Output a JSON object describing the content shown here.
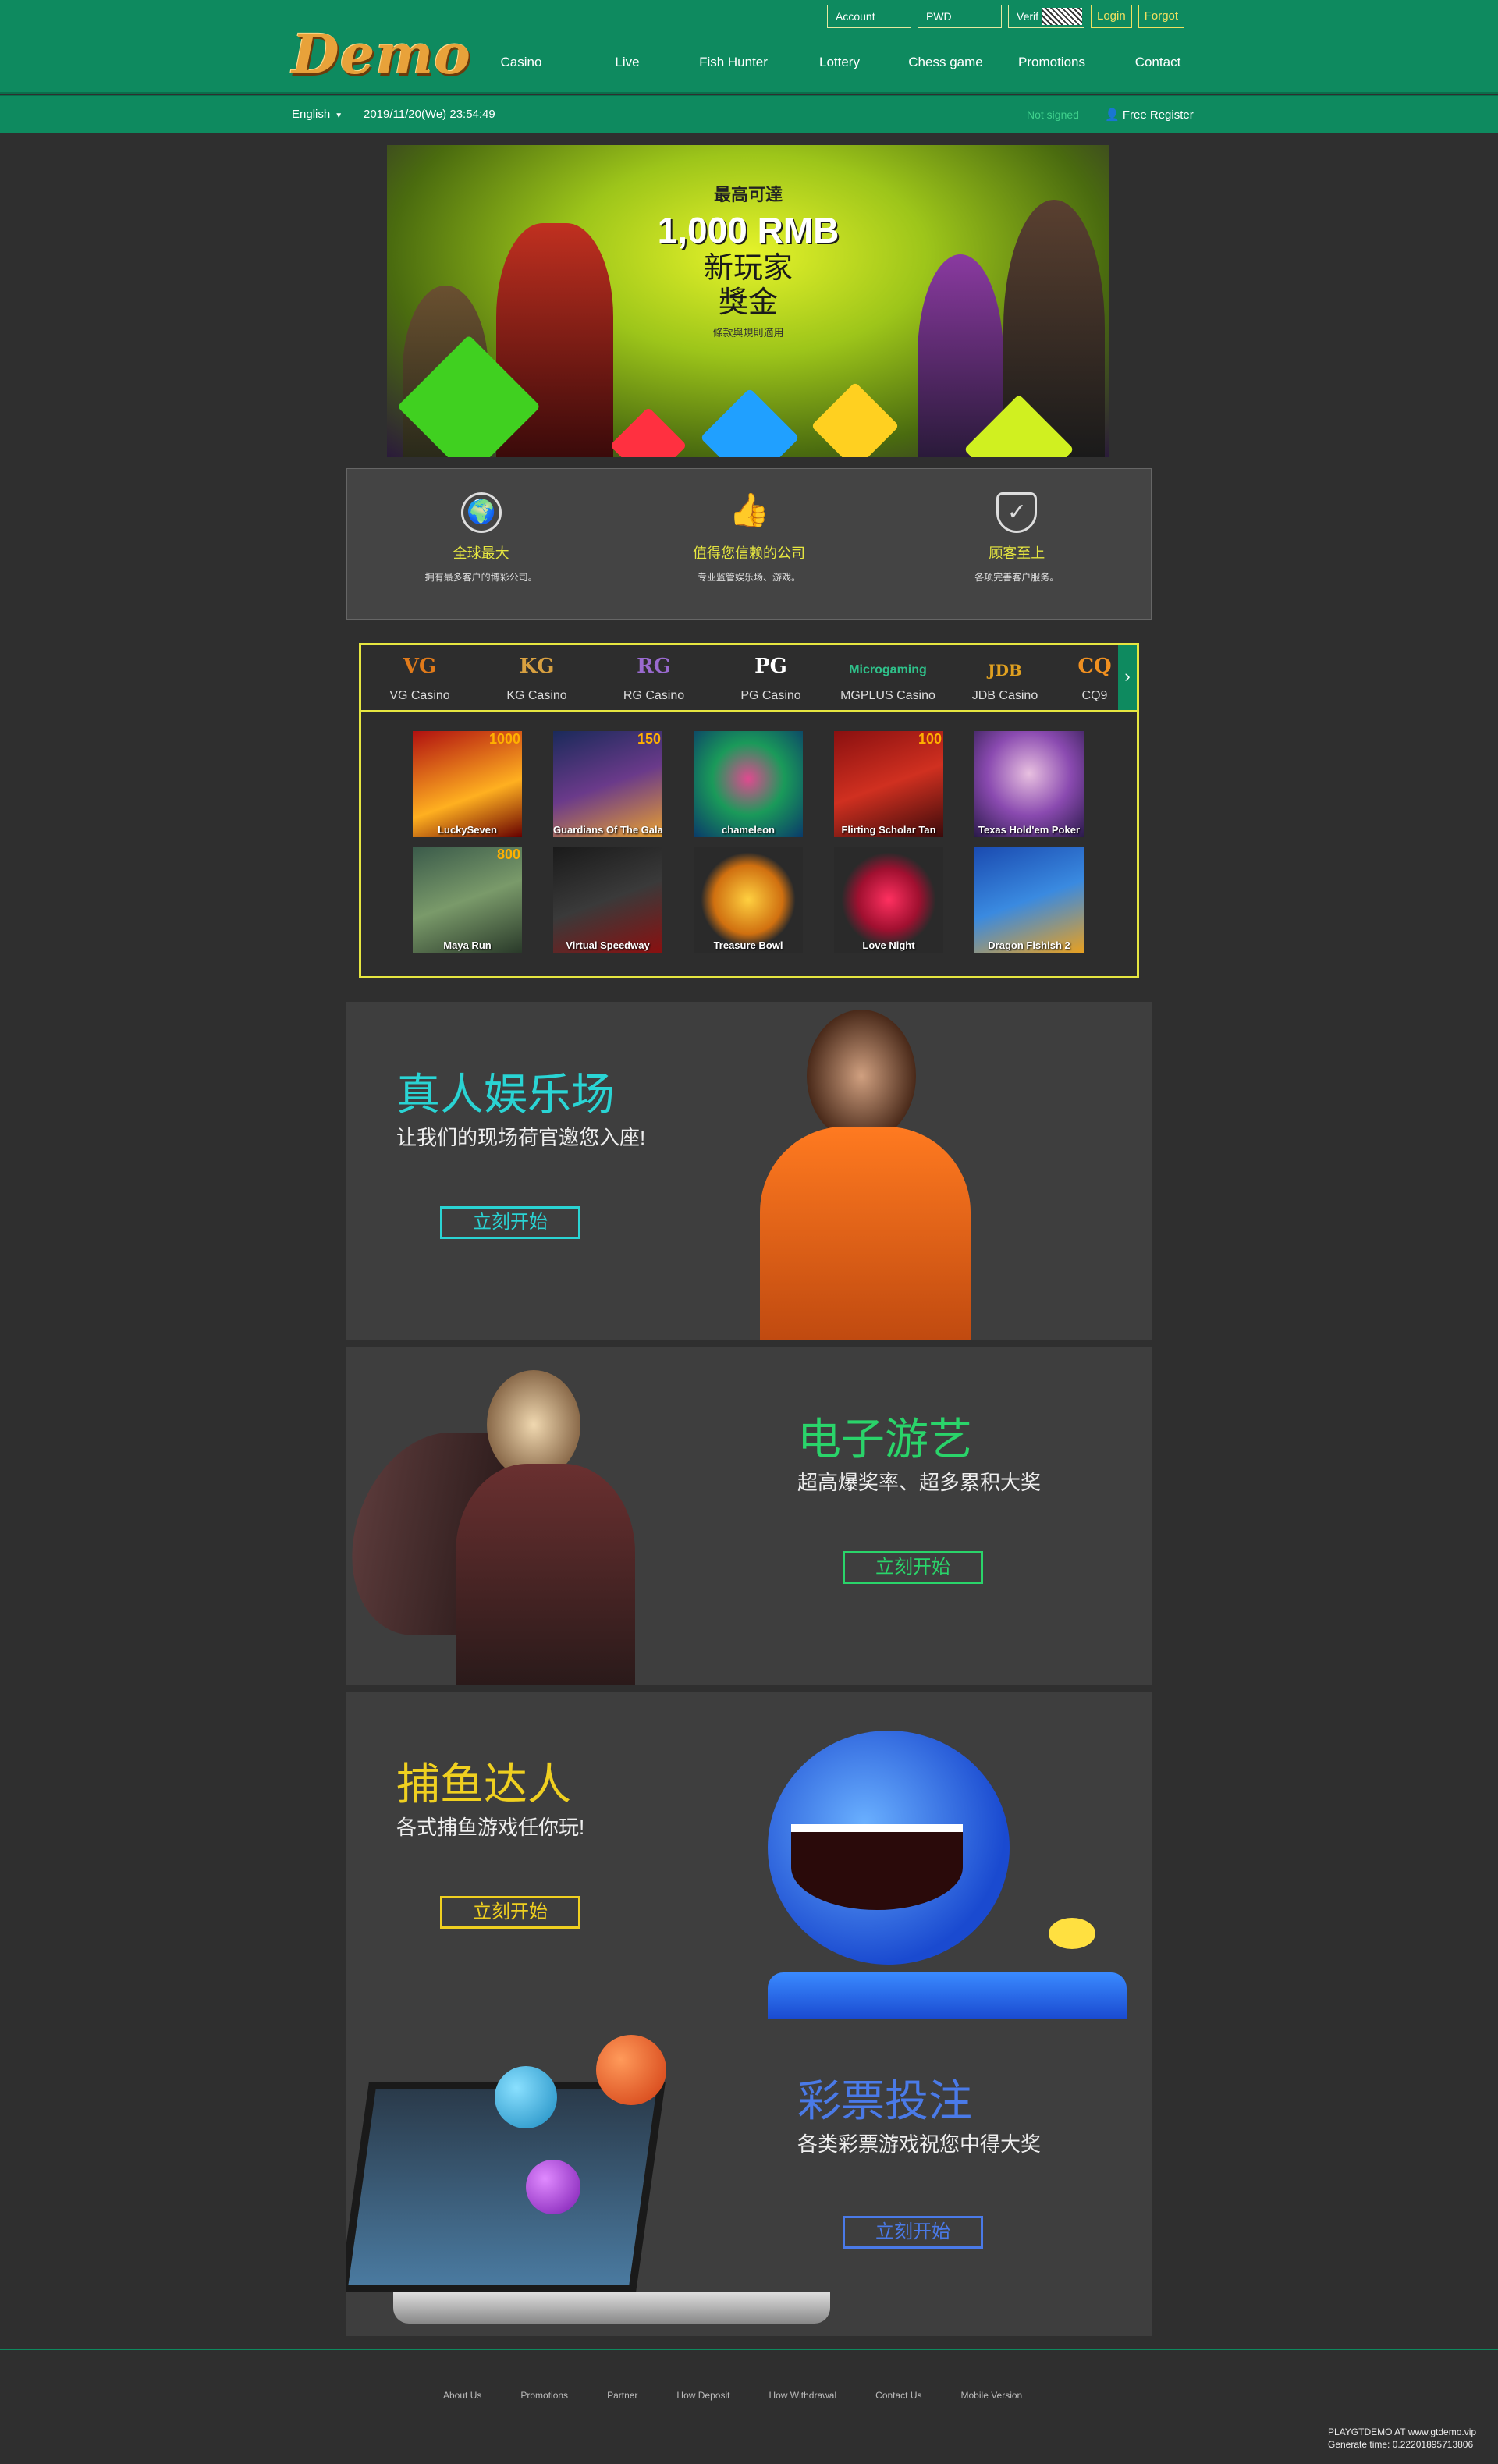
{
  "header": {
    "logo_text": "Demo",
    "nav": [
      "Casino",
      "Live",
      "Fish Hunter",
      "Lottery",
      "Chess game",
      "Promotions",
      "Contact"
    ],
    "account_placeholder": "Account",
    "pwd_placeholder": "PWD",
    "verif_placeholder": "Verif",
    "login_label": "Login",
    "forgot_label": "Forgot"
  },
  "subbar": {
    "language": "English",
    "datetime": "2019/11/20(We) 23:54:49",
    "status": "Not signed",
    "register": "Free Register"
  },
  "banner": {
    "line1": "最高可達",
    "line2": "1,000 RMB",
    "line3": "新玩家",
    "line4": "獎金",
    "line5": "條款與規則適用"
  },
  "features": [
    {
      "icon": "globe-icon",
      "title": "全球最大",
      "sub": "拥有最多客户的博彩公司。"
    },
    {
      "icon": "thumbs-up-icon",
      "title": "值得您信赖的公司",
      "sub": "专业监管娱乐场、游戏。"
    },
    {
      "icon": "shield-check-icon",
      "title": "顾客至上",
      "sub": "各项完善客户服务。"
    }
  ],
  "providers": [
    {
      "logo": "VG",
      "name": "VG Casino",
      "color": "#e07a1a"
    },
    {
      "logo": "KG",
      "name": "KG Casino",
      "color": "#d8a040"
    },
    {
      "logo": "RG",
      "name": "RG Casino",
      "color": "#9a6ad0"
    },
    {
      "logo": "PG",
      "name": "PG Casino",
      "color": "#ffffff"
    },
    {
      "logo": "Microgaming",
      "name": "MGPLUS Casino",
      "color": "#2fc08a"
    },
    {
      "logo": "JDB",
      "name": "JDB Casino",
      "color": "#e0a020"
    },
    {
      "logo": "CQ",
      "name": "CQ9",
      "color": "#f09020"
    }
  ],
  "games": [
    {
      "name": "LuckySeven",
      "num": "1000",
      "bg": "linear-gradient(160deg,#b01010,#ffb020 60%,#600)"
    },
    {
      "name": "Guardians Of The Galaxy",
      "num": "150",
      "bg": "linear-gradient(160deg,#1a2a5a,#6a3a8a 50%,#e8a030)"
    },
    {
      "name": "chameleon",
      "num": "",
      "bg": "radial-gradient(circle at 50% 45%,#e04a90,#1a9a5a 45%,#0a3a6a)"
    },
    {
      "name": "Flirting Scholar Tan",
      "num": "100",
      "bg": "linear-gradient(160deg,#8a1010,#d03020 50%,#3a0a0a)"
    },
    {
      "name": "Texas Hold'em Poker",
      "num": "",
      "bg": "radial-gradient(circle at 50% 40%,#e8c0e0,#8a4ab0 50%,#2a1a4a)"
    },
    {
      "name": "Maya Run",
      "num": "800",
      "bg": "linear-gradient(160deg,#3a5a4a,#7a9a6a 50%,#2a3a2a)"
    },
    {
      "name": "Virtual Speedway",
      "num": "",
      "bg": "linear-gradient(160deg,#1a1a1a,#3a3a3a 50%,#8a1010)"
    },
    {
      "name": "Treasure Bowl",
      "num": "",
      "bg": "radial-gradient(circle at 50% 50%,#ffd040,#d07010 45%,#2a2a2a 62%)"
    },
    {
      "name": "Love Night",
      "num": "",
      "bg": "radial-gradient(circle at 50% 50%,#ff3060,#a01030 40%,#2a2a2a 62%)"
    },
    {
      "name": "Dragon Fishish 2",
      "num": "",
      "bg": "linear-gradient(160deg,#1a4ab0,#3a8ae0 50%,#e8a020)"
    }
  ],
  "categories": [
    {
      "title": "真人娱乐场",
      "sub": "让我们的现场荷官邀您入座!",
      "button": "立刻开始",
      "color": "#2ad4d4"
    },
    {
      "title": "电子游艺",
      "sub": "超高爆奖率、超多累积大奖",
      "button": "立刻开始",
      "color": "#2ad46a"
    },
    {
      "title": "捕鱼达人",
      "sub": "各式捕鱼游戏任你玩!",
      "button": "立刻开始",
      "color": "#f0d020"
    },
    {
      "title": "彩票投注",
      "sub": "各类彩票游戏祝您中得大奖",
      "button": "立刻开始",
      "color": "#4a7ae8"
    }
  ],
  "footer": {
    "links": [
      "About Us",
      "Promotions",
      "Partner",
      "How Deposit",
      "How Withdrawal",
      "Contact Us",
      "Mobile Version"
    ],
    "brand": "PLAYGTDEMO AT www.gtdemo.vip",
    "generate": "Generate time: 0.22201895713806"
  }
}
